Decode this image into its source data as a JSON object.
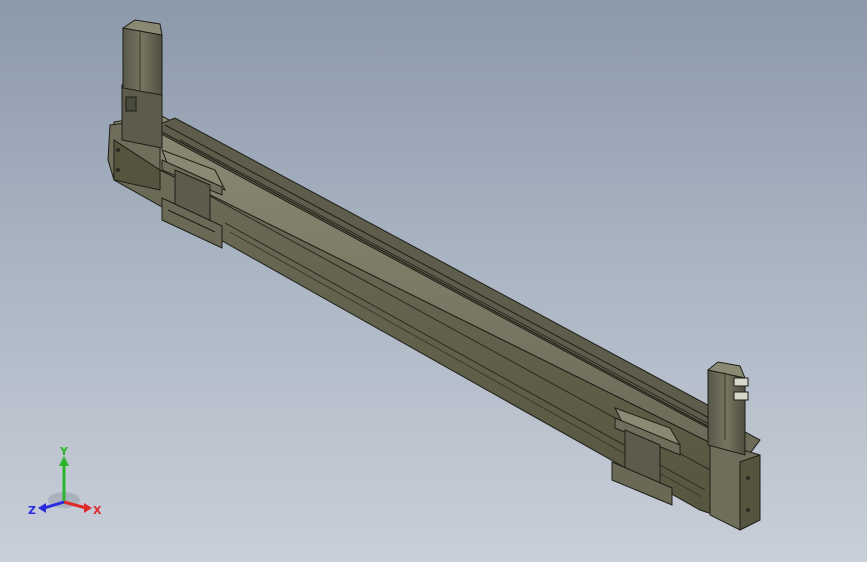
{
  "viewport": {
    "background_top": "#8c99ab",
    "background_bottom": "#c9cfd9"
  },
  "model": {
    "body_color": "#646352",
    "body_highlight": "#8a8a74",
    "body_shadow": "#4a4a3d",
    "edge_color": "#1e1e18"
  },
  "triad": {
    "x_label": "X",
    "y_label": "Y",
    "z_label": "Z",
    "x_color": "#e02a2a",
    "y_color": "#2bb52b",
    "z_color": "#2a2ae0"
  }
}
